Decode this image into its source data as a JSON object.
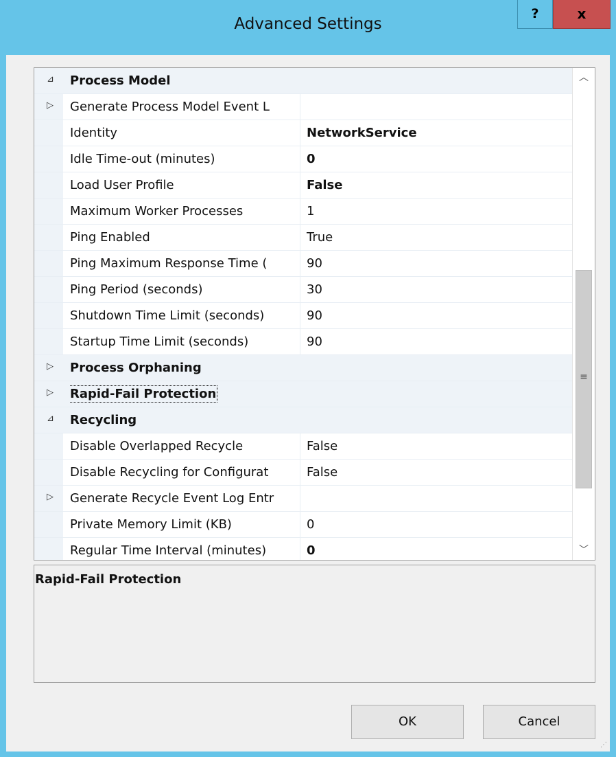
{
  "window": {
    "title": "Advanced Settings",
    "help_label": "?",
    "close_label": "x"
  },
  "grid": {
    "rows": [
      {
        "kind": "category",
        "expander": "⊿",
        "name": "Process Model"
      },
      {
        "kind": "property",
        "expander": "▷",
        "name": "Generate Process Model Event L",
        "value": "",
        "bold": false
      },
      {
        "kind": "property",
        "expander": "",
        "name": "Identity",
        "value": "NetworkService",
        "bold": true
      },
      {
        "kind": "property",
        "expander": "",
        "name": "Idle Time-out (minutes)",
        "value": "0",
        "bold": true
      },
      {
        "kind": "property",
        "expander": "",
        "name": "Load User Profile",
        "value": "False",
        "bold": true
      },
      {
        "kind": "property",
        "expander": "",
        "name": "Maximum Worker Processes",
        "value": "1",
        "bold": false
      },
      {
        "kind": "property",
        "expander": "",
        "name": "Ping Enabled",
        "value": "True",
        "bold": false
      },
      {
        "kind": "property",
        "expander": "",
        "name": "Ping Maximum Response Time (",
        "value": "90",
        "bold": false
      },
      {
        "kind": "property",
        "expander": "",
        "name": "Ping Period (seconds)",
        "value": "30",
        "bold": false
      },
      {
        "kind": "property",
        "expander": "",
        "name": "Shutdown Time Limit (seconds)",
        "value": "90",
        "bold": false
      },
      {
        "kind": "property",
        "expander": "",
        "name": "Startup Time Limit (seconds)",
        "value": "90",
        "bold": false
      },
      {
        "kind": "category",
        "expander": "▷",
        "name": "Process Orphaning"
      },
      {
        "kind": "category",
        "expander": "▷",
        "name": "Rapid-Fail Protection",
        "focused": true
      },
      {
        "kind": "category",
        "expander": "⊿",
        "name": "Recycling"
      },
      {
        "kind": "property",
        "expander": "",
        "name": "Disable Overlapped Recycle",
        "value": "False",
        "bold": false
      },
      {
        "kind": "property",
        "expander": "",
        "name": "Disable Recycling for Configurat",
        "value": "False",
        "bold": false
      },
      {
        "kind": "property",
        "expander": "▷",
        "name": "Generate Recycle Event Log Entr",
        "value": "",
        "bold": false
      },
      {
        "kind": "property",
        "expander": "",
        "name": "Private Memory Limit (KB)",
        "value": "0",
        "bold": false
      },
      {
        "kind": "property",
        "expander": "",
        "name": "Regular Time Interval (minutes)",
        "value": "0",
        "bold": true
      }
    ],
    "scroll_up": "︿",
    "scroll_down": "﹀",
    "scroll_grip": "≡"
  },
  "description": {
    "title": "Rapid-Fail Protection"
  },
  "buttons": {
    "ok_label": "OK",
    "cancel_label": "Cancel"
  }
}
